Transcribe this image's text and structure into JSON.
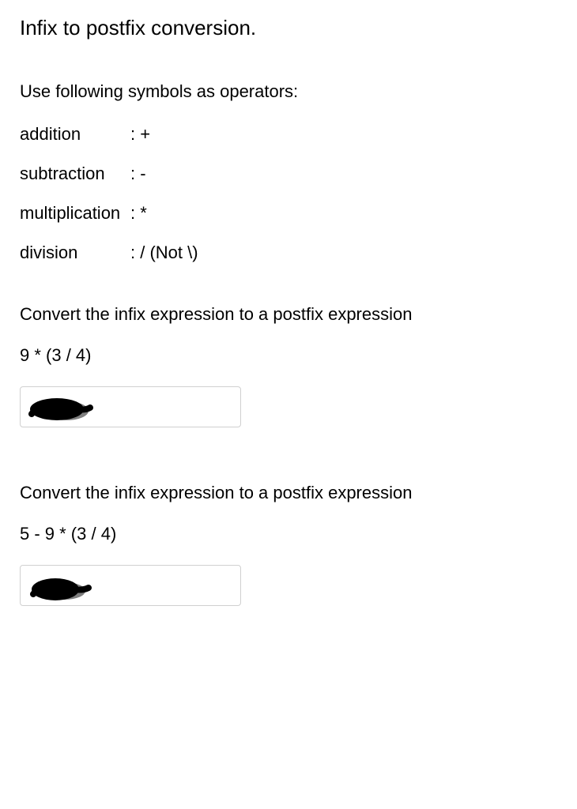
{
  "title": "Infix to postfix conversion.",
  "instructions": "Use following symbols as operators:",
  "operators": [
    {
      "label": "addition",
      "symbol": ": +"
    },
    {
      "label": "subtraction",
      "symbol": ": -"
    },
    {
      "label": "multiplication",
      "symbol": ": *"
    },
    {
      "label": "division",
      "symbol": ": /  (Not \\)"
    }
  ],
  "questions": [
    {
      "prompt": "Convert the infix expression to a postfix expression",
      "expression": "9  *  (3 / 4)"
    },
    {
      "prompt": "Convert the infix expression to a postfix expression",
      "expression": "5 - 9  *  (3 / 4)"
    }
  ]
}
